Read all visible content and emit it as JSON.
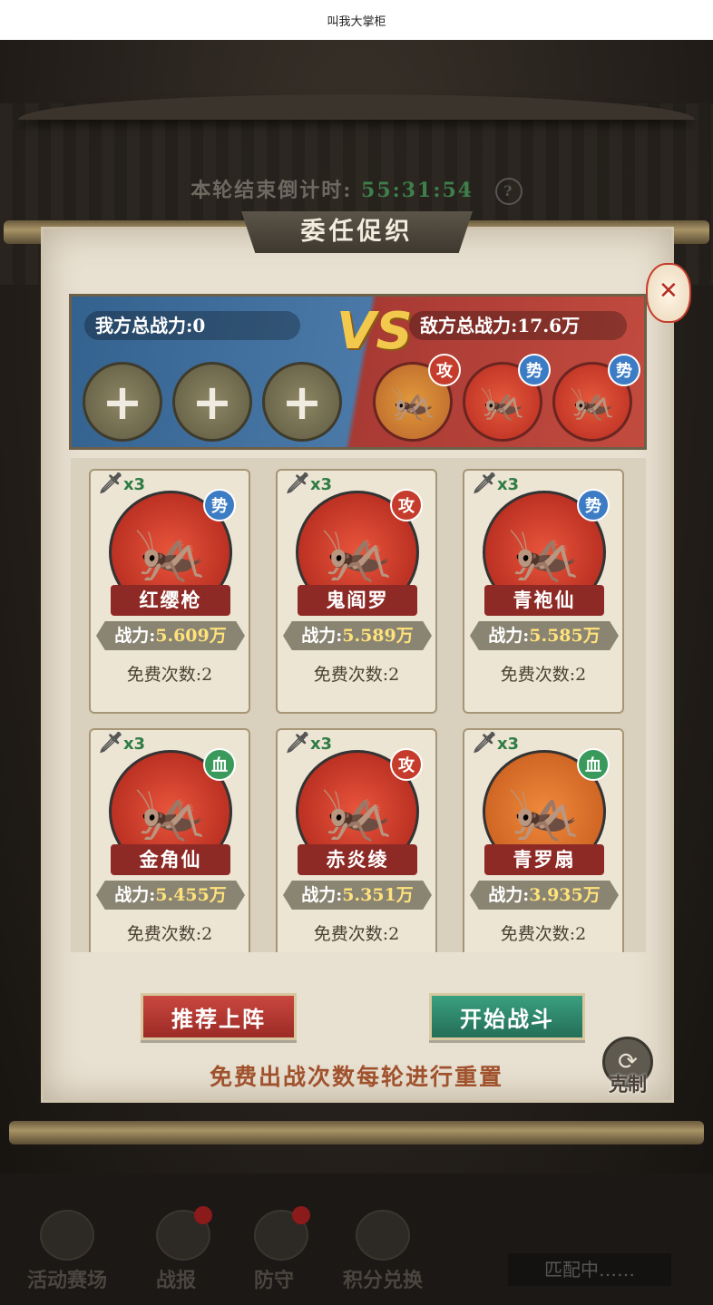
{
  "app": {
    "title": "叫我大掌柜"
  },
  "header": {
    "countdown_label": "本轮结束倒计时:",
    "countdown_time": "55:31:54",
    "help_icon": "?"
  },
  "panel": {
    "title": "委任促织",
    "my_side": {
      "power_label": "我方总战力:0",
      "slots": [
        "+",
        "+",
        "+"
      ]
    },
    "vs_label": "VS",
    "enemy_side": {
      "power_label": "敌方总战力:17.6万",
      "units": [
        {
          "tag": "攻",
          "tag_type": "gong",
          "icon": "cricket-icon"
        },
        {
          "tag": "势",
          "tag_type": "shi",
          "icon": "cricket-icon"
        },
        {
          "tag": "势",
          "tag_type": "shi",
          "icon": "cricket-icon"
        }
      ]
    },
    "cards": [
      {
        "multiplier": "x3",
        "tag": "势",
        "tag_type": "shi",
        "name": "红缨枪",
        "power_label": "战力:",
        "power": "5.609万",
        "free": "免费次数:2",
        "bg": "#b82a20"
      },
      {
        "multiplier": "x3",
        "tag": "攻",
        "tag_type": "gong",
        "name": "鬼阎罗",
        "power_label": "战力:",
        "power": "5.589万",
        "free": "免费次数:2",
        "bg": "#b82a20"
      },
      {
        "multiplier": "x3",
        "tag": "势",
        "tag_type": "shi",
        "name": "青袍仙",
        "power_label": "战力:",
        "power": "5.585万",
        "free": "免费次数:2",
        "bg": "#b82a20"
      },
      {
        "multiplier": "x3",
        "tag": "血",
        "tag_type": "xue",
        "name": "金角仙",
        "power_label": "战力:",
        "power": "5.455万",
        "free": "免费次数:2",
        "bg": "#b82a20"
      },
      {
        "multiplier": "x3",
        "tag": "攻",
        "tag_type": "gong",
        "name": "赤炎绫",
        "power_label": "战力:",
        "power": "5.351万",
        "free": "免费次数:2",
        "bg": "#b82a20"
      },
      {
        "multiplier": "x3",
        "tag": "血",
        "tag_type": "xue",
        "name": "青罗扇",
        "power_label": "战力:",
        "power": "3.935万",
        "free": "免费次数:2",
        "bg": "#c9641e"
      }
    ],
    "buttons": {
      "recommend": "推荐上阵",
      "start": "开始战斗"
    },
    "notice": "免费出战次数每轮进行重置",
    "counter": {
      "label": "克制",
      "icon": "cycle-icon"
    }
  },
  "bottom_nav": {
    "items": [
      {
        "label": "活动赛场",
        "badge": false
      },
      {
        "label": "战报",
        "badge": true
      },
      {
        "label": "防守",
        "badge": true
      },
      {
        "label": "积分兑换",
        "badge": false
      }
    ],
    "matching": "匹配中……"
  }
}
